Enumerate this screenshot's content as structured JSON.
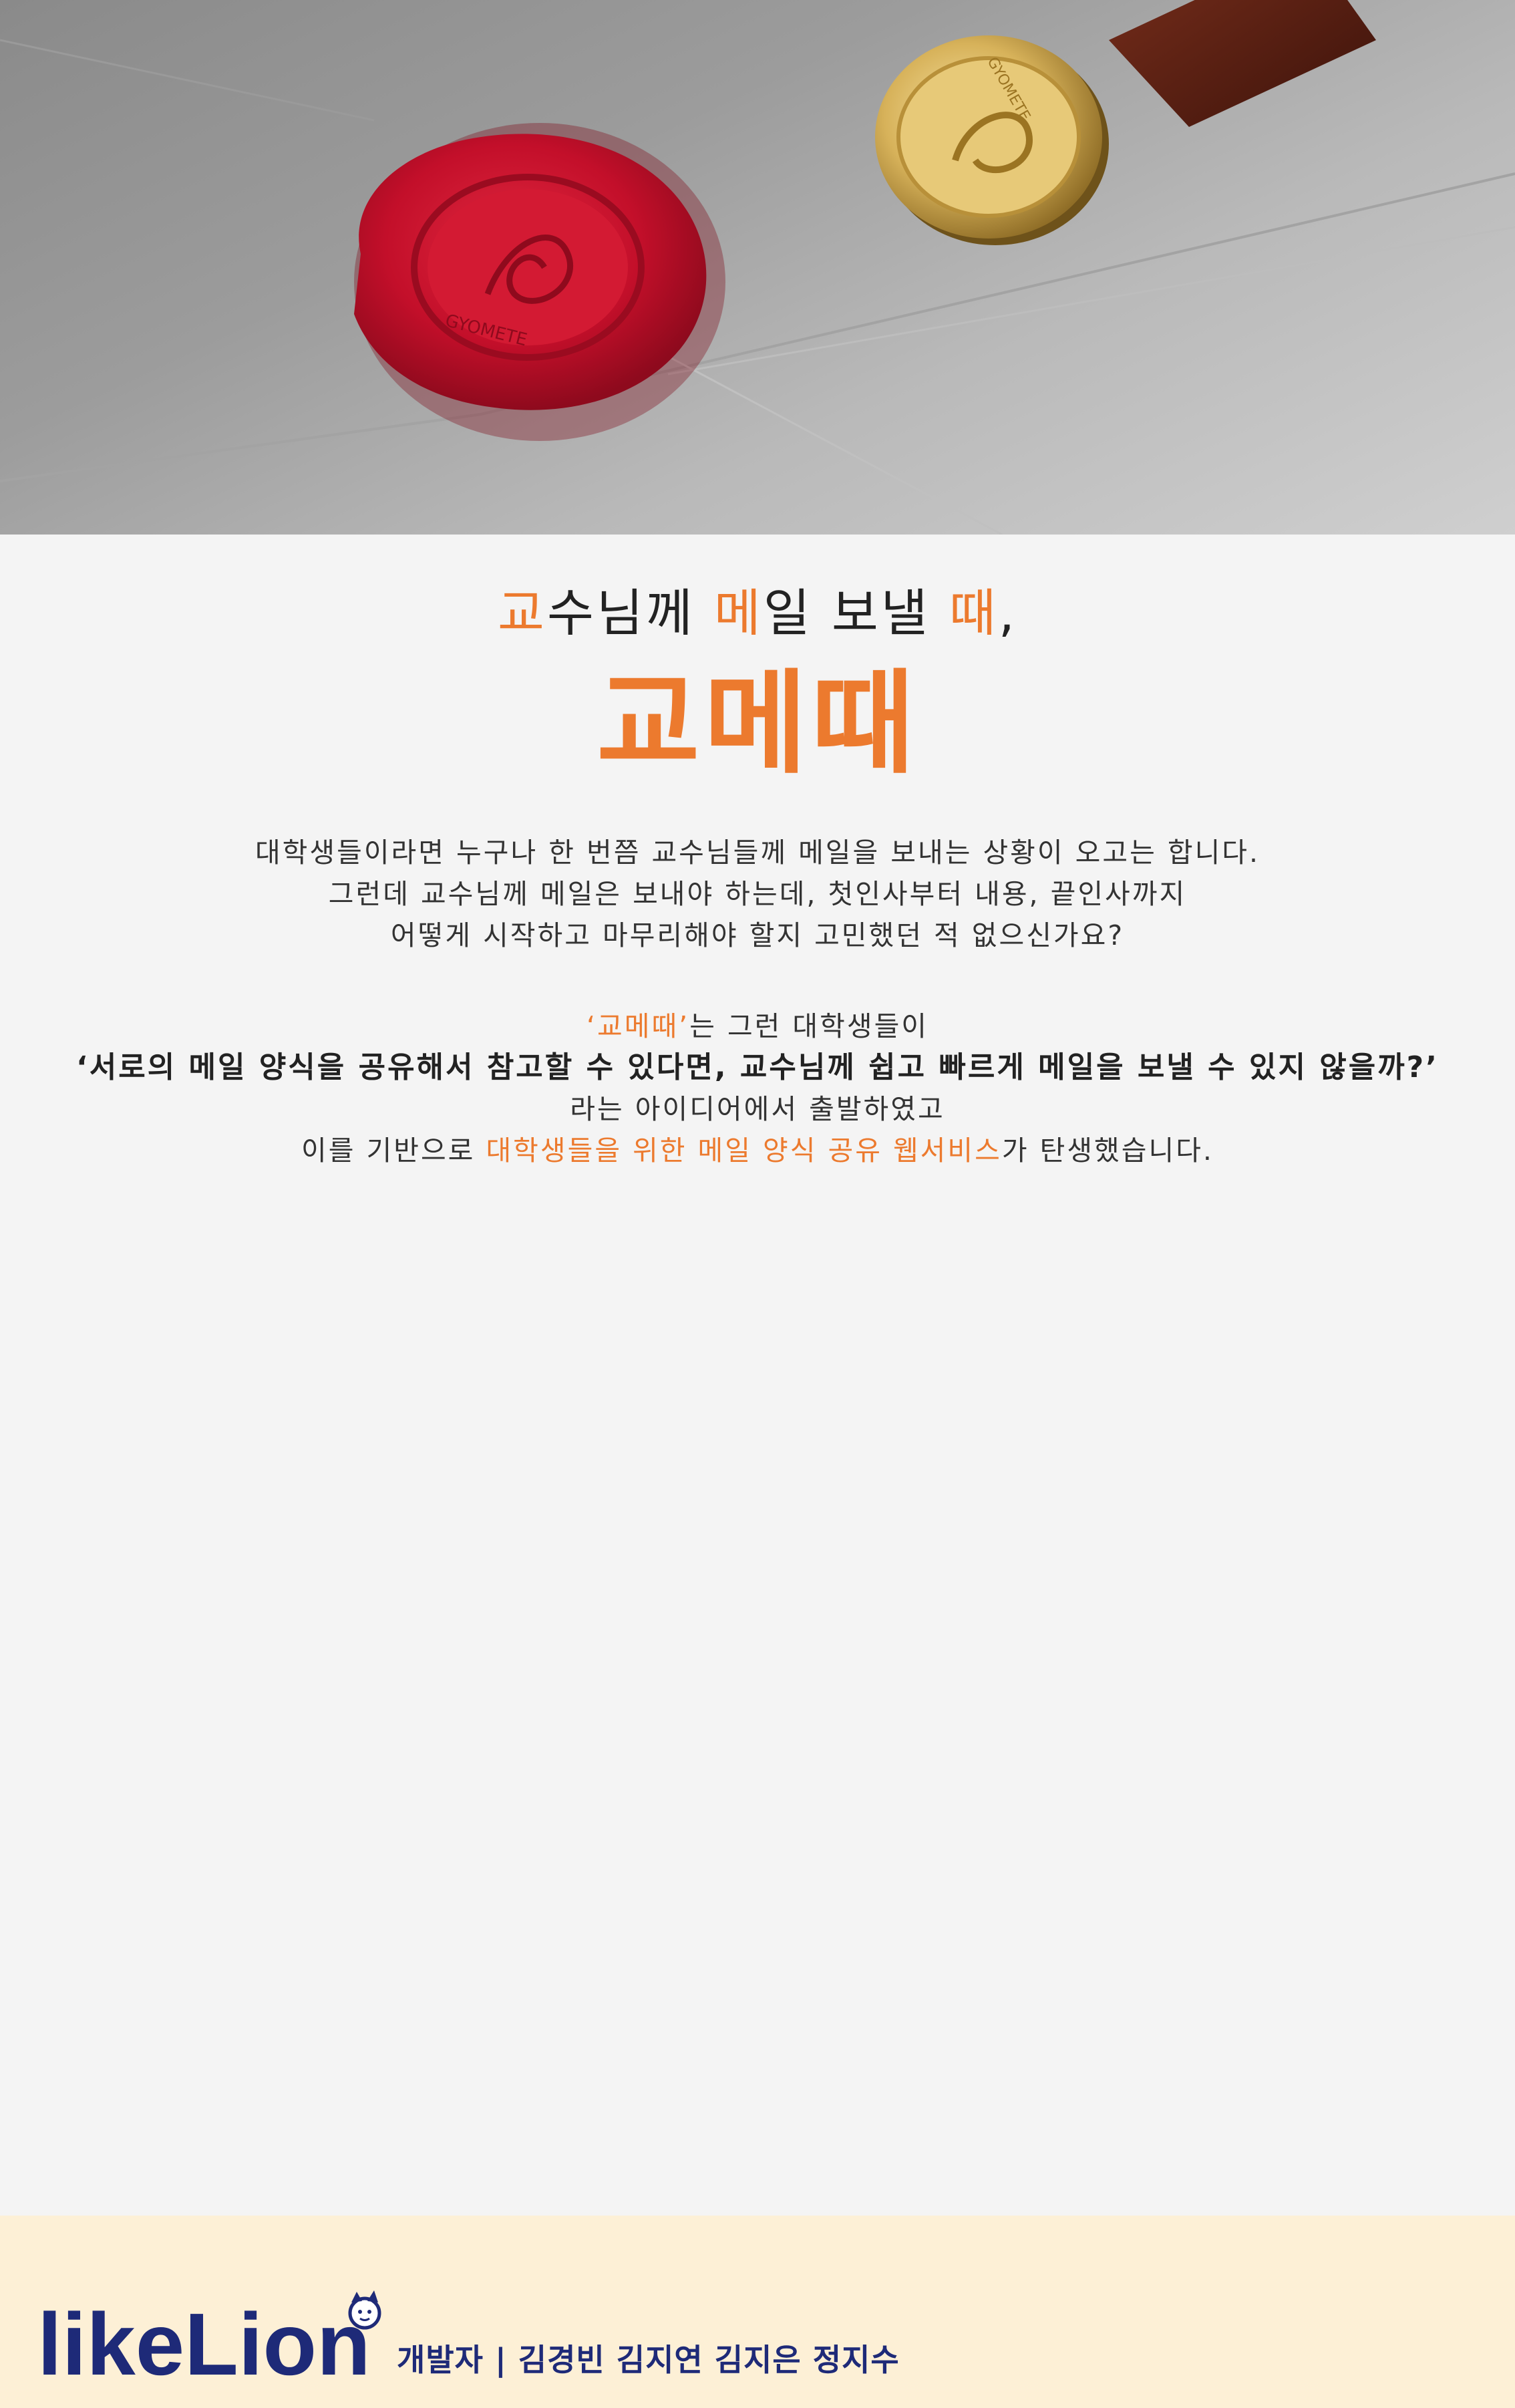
{
  "hero": {
    "seal_text": "GYOMETE",
    "stamp_text": "GYOMETE"
  },
  "headline": {
    "line1_part1": "교",
    "line1_part2": "수님께 ",
    "line1_part3": "메",
    "line1_part4": "일 보낼 ",
    "line1_part5": "때",
    "line1_part6": ",",
    "logo": "교메때"
  },
  "intro": {
    "line1": "대학생들이라면 누구나 한 번쯤 교수님들께 메일을 보내는 상황이 오고는 합니다.",
    "line2": "그런데 교수님께 메일은 보내야 하는데, 첫인사부터 내용, 끝인사까지",
    "line3": "어떻게 시작하고 마무리해야 할지 고민했던 적 없으신가요?"
  },
  "pitch": {
    "line1_accent": "‘교메때’",
    "line1_rest": "는 그런 대학생들이",
    "line2": "‘서로의 메일 양식을 공유해서 참고할 수 있다면, 교수님께 쉽고 빠르게 메일을 보낼 수 있지 않을까?’",
    "line3": "라는 아이디어에서 출발하였고",
    "line4_pre": "이를 기반으로 ",
    "line4_accent": "대학생들을 위한 메일 양식 공유 웹서비스",
    "line4_post": "가 탄생했습니다."
  },
  "footer": {
    "brand": "likeLion",
    "credits": "개발자 | 김경빈 김지연 김지은 정지수"
  },
  "colors": {
    "accent": "#ec7a2e",
    "brand_navy": "#1e2a78",
    "footer_bg": "#fdf0d6",
    "wax_red": "#c8102e"
  }
}
